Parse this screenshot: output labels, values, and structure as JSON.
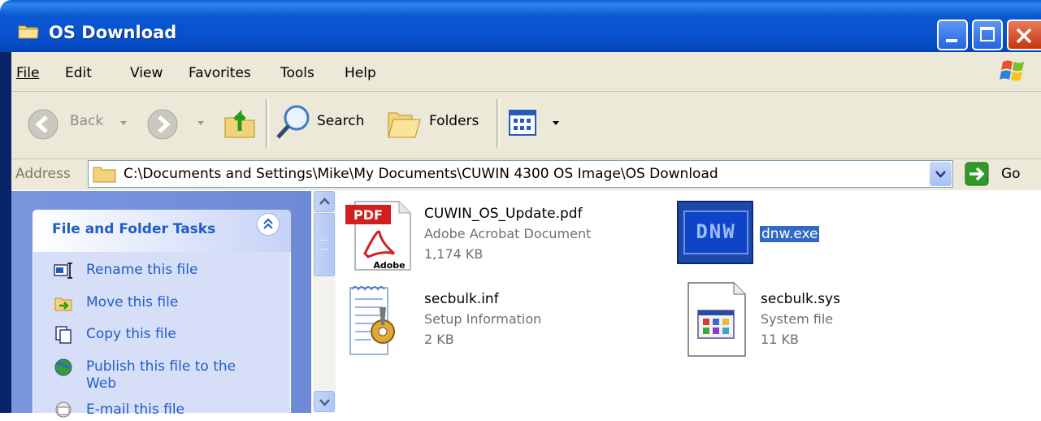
{
  "window": {
    "title": "OS Download"
  },
  "menu": [
    {
      "label": "File"
    },
    {
      "label": "Edit"
    },
    {
      "label": "View"
    },
    {
      "label": "Favorites"
    },
    {
      "label": "Tools"
    },
    {
      "label": "Help"
    }
  ],
  "toolbar": {
    "back_label": "Back",
    "search_label": "Search",
    "folders_label": "Folders"
  },
  "address": {
    "label": "Address",
    "path": "C:\\Documents and Settings\\Mike\\My Documents\\CUWIN 4300 OS Image\\OS Download",
    "go_label": "Go"
  },
  "taskpane": {
    "title": "File and Folder Tasks",
    "tasks": [
      {
        "label": "Rename this file",
        "icon": "rename-icon"
      },
      {
        "label": "Move this file",
        "icon": "move-icon"
      },
      {
        "label": "Copy this file",
        "icon": "copy-icon"
      },
      {
        "label": "Publish this file to the",
        "label2": "Web",
        "icon": "publish-icon"
      },
      {
        "label": "E-mail this file",
        "icon": "email-icon"
      }
    ]
  },
  "files": [
    {
      "name": "CUWIN_OS_Update.pdf",
      "type": "Adobe Acrobat Document",
      "size": "1,174 KB",
      "icon": "pdf-icon"
    },
    {
      "name": "dnw.exe",
      "icon": "dnw-exe-icon",
      "selected": true,
      "icon_text": "DNW"
    },
    {
      "name": "secbulk.inf",
      "type": "Setup Information",
      "size": "2 KB",
      "icon": "setup-info-icon"
    },
    {
      "name": "secbulk.sys",
      "type": "System file",
      "size": "11 KB",
      "icon": "system-file-icon"
    }
  ],
  "icons": {
    "pdf_badge": "PDF",
    "pdf_brand": "Adobe"
  },
  "colors": {
    "titlebar": "#0a58d2",
    "selection": "#316ac5",
    "link": "#215dc6"
  }
}
